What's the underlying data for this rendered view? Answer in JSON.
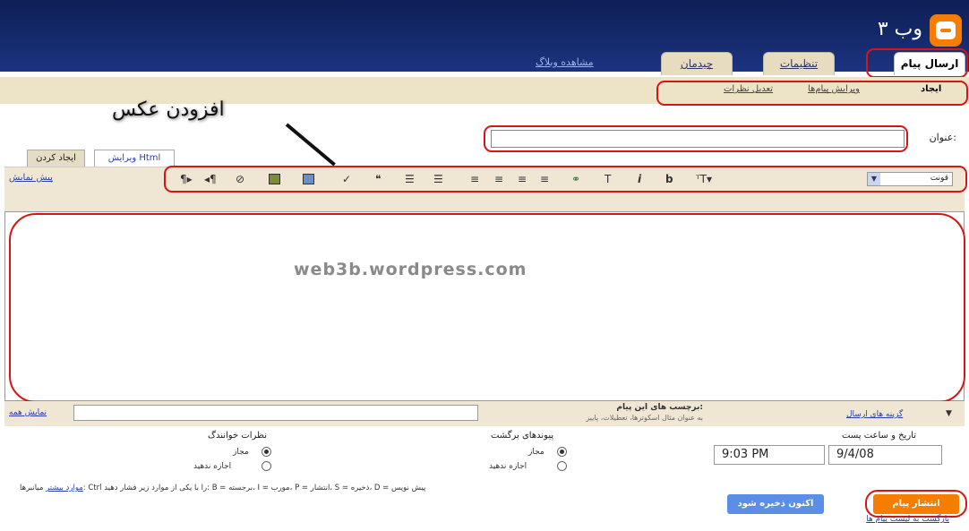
{
  "header": {
    "blog_title": "وب ۳",
    "view_blog_link": "مشاهده وبلاگ"
  },
  "tabs": [
    {
      "label": "ارسال پیام",
      "active": true
    },
    {
      "label": "تنظیمات",
      "active": false
    },
    {
      "label": "چیدمان",
      "active": false
    }
  ],
  "subtabs": [
    {
      "label": "ایجاد",
      "active": true
    },
    {
      "label": "ویرایش پیام‌ها",
      "active": false
    },
    {
      "label": "تعدیل نظرات",
      "active": false
    }
  ],
  "annotation": {
    "add_photo_label": "افزودن عکس"
  },
  "post": {
    "title_label": "عنوان:",
    "title_value": "",
    "mode_tabs": [
      "ایجاد کردن",
      "ویرایش Html"
    ],
    "preview_link": "پیش نمایش",
    "font_label": "قونت",
    "editor_watermark": "web3b.wordpress.com"
  },
  "toolbar": {
    "icons": [
      "font-size-icon",
      "bold-icon",
      "italic-icon",
      "text-color-icon",
      "link-icon",
      "align-left-icon",
      "align-center-icon",
      "align-right-icon",
      "justify-icon",
      "numbered-list-icon",
      "bullet-list-icon",
      "blockquote-icon",
      "spellcheck-icon",
      "add-image-icon",
      "add-video-icon",
      "remove-format-icon",
      "rtl-icon",
      "ltr-icon"
    ]
  },
  "labels": {
    "post_options_link": "گزینه های ارسال",
    "labels_title": "برچسب های این پیام:",
    "labels_example": "به عنوان مثال اسکوترها، تعطیلات، پاییز",
    "show_all_link": "نمایش همه"
  },
  "options": {
    "reader_comments_title": "نظرات خوانندگ",
    "backlinks_title": "پیوندهای برگشت",
    "allow": "مجاز",
    "deny": "اجازه ندهید",
    "datetime_title": "تاریخ و ساعت پست",
    "time_value": "9:03 PM",
    "date_value": "9/4/08"
  },
  "shortcuts": {
    "hint_text": "میانبرها: Ctrl را با یکی از موارد زیر فشار دهید: B = برجسته، I = مورب، P = انتشار، S = ذخیره، D = پیش نویس",
    "more_link": "موارد بیشتر"
  },
  "actions": {
    "publish": "انتشار پیام",
    "save_now": "اکنون ذخیره شود",
    "back_link": "بازگشت به لیست پیام ها"
  },
  "colors": {
    "header": "#1c3380",
    "highlight": "#d61515",
    "publish": "#f57d00",
    "save": "#5b8ee6"
  }
}
